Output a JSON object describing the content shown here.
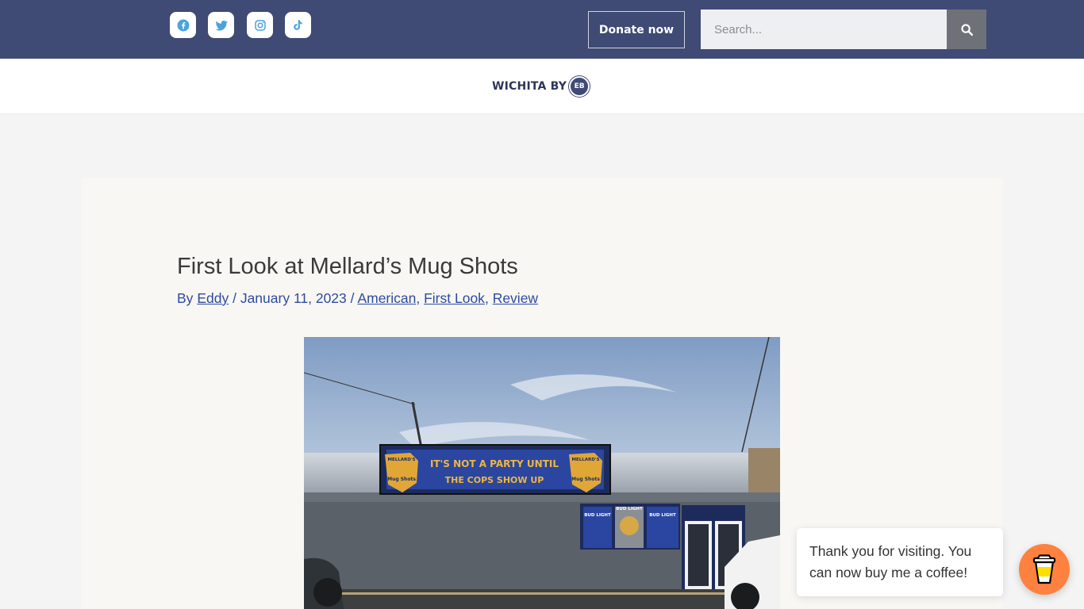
{
  "topbar": {
    "social": [
      {
        "name": "facebook-icon",
        "label": "Facebook"
      },
      {
        "name": "twitter-icon",
        "label": "Twitter"
      },
      {
        "name": "instagram-icon",
        "label": "Instagram"
      },
      {
        "name": "tiktok-icon",
        "label": "TikTok"
      }
    ],
    "donate_label": "Donate now",
    "search_placeholder": "Search..."
  },
  "header": {
    "logo_text": "WICHITA BY",
    "logo_badge": "EB"
  },
  "article": {
    "title": "First Look at Mellard’s Mug Shots",
    "by_prefix": "By",
    "author": "Eddy",
    "separator1": "/",
    "date": "January 11, 2023",
    "separator2": "/",
    "categories": [
      "American",
      "First Look",
      "Review"
    ]
  },
  "photo_sign": {
    "main_line1": "IT'S NOT A PARTY UNTIL",
    "main_line2": "THE COPS SHOW UP",
    "badge_top": "MELLARD'S",
    "badge_bottom": "Mug Shots",
    "poster": "BUD LIGHT"
  },
  "coffee_widget": {
    "message": "Thank you for visiting. You can now buy me a coffee!"
  },
  "colors": {
    "topbar": "#3f4a75",
    "link": "#2f4aa0",
    "coffee": "#ff813f"
  }
}
